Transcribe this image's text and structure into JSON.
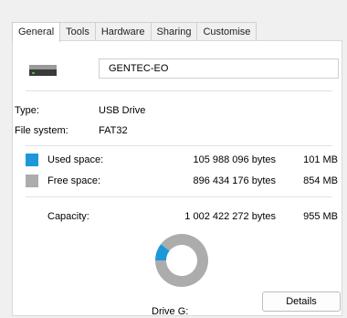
{
  "tabs": [
    "General",
    "Tools",
    "Hardware",
    "Sharing",
    "Customise"
  ],
  "drive": {
    "name": "GENTEC-EO"
  },
  "type": {
    "label": "Type:",
    "value": "USB Drive"
  },
  "filesystem": {
    "label": "File system:",
    "value": "FAT32"
  },
  "used": {
    "label": "Used space:",
    "bytes": "105 988 096 bytes",
    "size": "101 MB",
    "color": "#1c98d8"
  },
  "free": {
    "label": "Free space:",
    "bytes": "896 434 176 bytes",
    "size": "854 MB",
    "color": "#acacac"
  },
  "capacity": {
    "label": "Capacity:",
    "bytes": "1 002 422 272 bytes",
    "size": "955 MB"
  },
  "chart_data": {
    "type": "pie",
    "categories": [
      "Used space",
      "Free space"
    ],
    "values": [
      105988096,
      896434176
    ],
    "colors": [
      "#1c98d8",
      "#acacac"
    ]
  },
  "drive_label": "Drive G:",
  "details_button": "Details"
}
